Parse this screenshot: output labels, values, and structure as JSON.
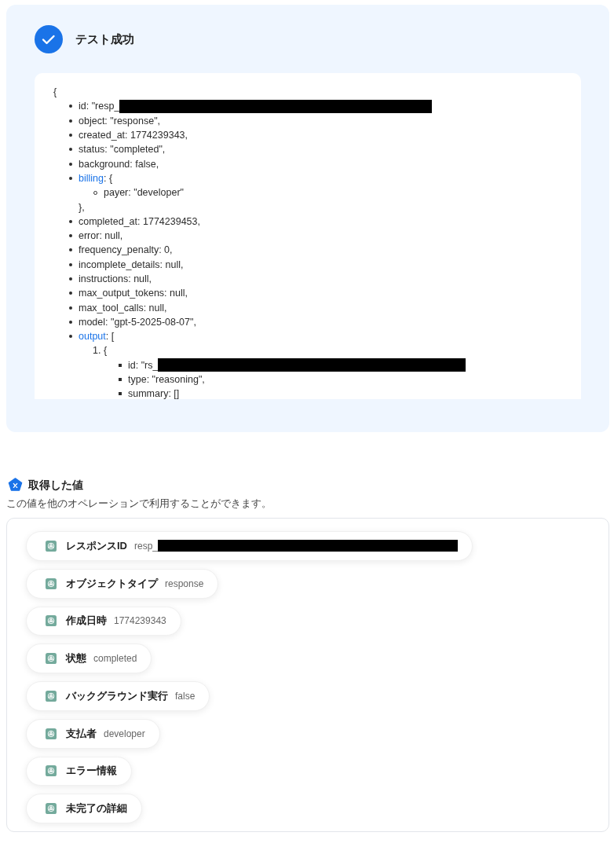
{
  "result": {
    "title": "テスト成功",
    "kind": "success",
    "code": {
      "open": "{",
      "items": [
        {
          "text": "id: \"resp_",
          "redacted": true
        },
        {
          "text": "object: \"response\","
        },
        {
          "text": "created_at: 1774239343,"
        },
        {
          "text": "status: \"completed\","
        },
        {
          "text": "background: false,"
        },
        {
          "key": "billing",
          "text": ": {",
          "children": [
            {
              "text": "payer: \"developer\""
            }
          ],
          "close": "},"
        },
        {
          "text": "completed_at: 1774239453,"
        },
        {
          "text": "error: null,"
        },
        {
          "text": "frequency_penalty: 0,"
        },
        {
          "text": "incomplete_details: null,"
        },
        {
          "text": "instructions: null,"
        },
        {
          "text": "max_output_tokens: null,"
        },
        {
          "text": "max_tool_calls: null,"
        },
        {
          "text": "model: \"gpt-5-2025-08-07\","
        },
        {
          "key": "output",
          "text": ": [",
          "ordered": [
            {
              "marker": "1.",
              "text": "{",
              "children": [
                {
                  "text": "id: \"rs_",
                  "redacted": true
                },
                {
                  "text": "type: \"reasoning\","
                },
                {
                  "text": "summary: []"
                }
              ]
            }
          ]
        }
      ]
    }
  },
  "values": {
    "title": "取得した値",
    "description": "この値を他のオペレーションで利用することができます。",
    "items": [
      {
        "label": "レスポンスID",
        "value": "resp_",
        "redacted": true
      },
      {
        "label": "オブジェクトタイプ",
        "value": "response"
      },
      {
        "label": "作成日時",
        "value": "1774239343"
      },
      {
        "label": "状態",
        "value": "completed"
      },
      {
        "label": "バックグラウンド実行",
        "value": "false"
      },
      {
        "label": "支払者",
        "value": "developer"
      },
      {
        "label": "エラー情報"
      },
      {
        "label": "未完了の詳細"
      }
    ]
  }
}
